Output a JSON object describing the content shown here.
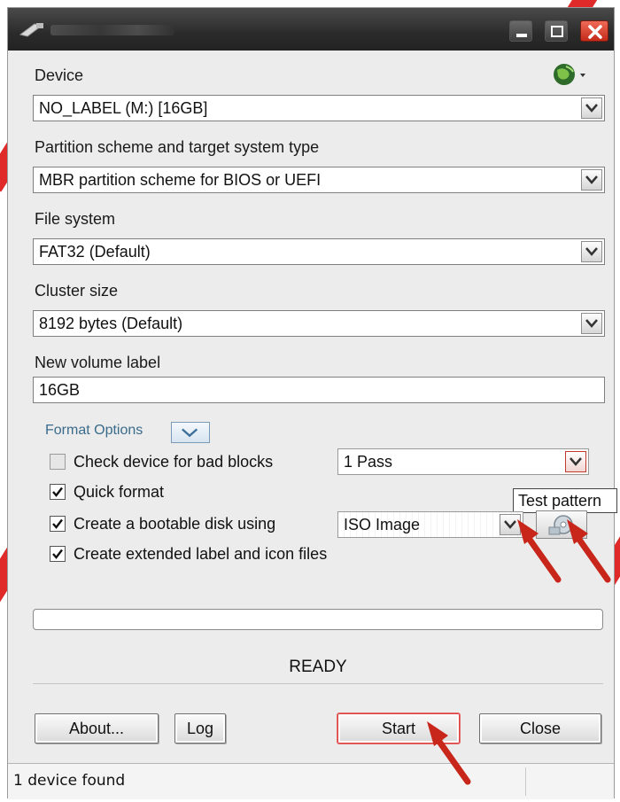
{
  "window": {
    "title": ""
  },
  "device": {
    "label": "Device",
    "value": "NO_LABEL (M:) [16GB]"
  },
  "partition": {
    "label": "Partition scheme and target system type",
    "value": "MBR partition scheme for BIOS or UEFI"
  },
  "filesystem": {
    "label": "File system",
    "value": "FAT32 (Default)"
  },
  "cluster": {
    "label": "Cluster size",
    "value": "8192 bytes (Default)"
  },
  "volume": {
    "label": "New volume label",
    "value": "16GB"
  },
  "format_options": {
    "label": "Format Options",
    "bad_blocks": {
      "label": "Check device for bad blocks",
      "checked": false,
      "passes": "1 Pass"
    },
    "quick_format": {
      "label": "Quick format",
      "checked": true
    },
    "bootable": {
      "label": "Create a bootable disk using",
      "checked": true,
      "value": "ISO Image"
    },
    "extended_label": {
      "label": "Create extended label and icon files",
      "checked": true
    }
  },
  "tooltip": "Test pattern",
  "progress": {
    "fraction": 0.0
  },
  "status": "READY",
  "buttons": {
    "about": "About...",
    "log": "Log",
    "start": "Start",
    "close": "Close"
  },
  "statusbar": {
    "text": "1 device found"
  },
  "colors": {
    "accent_red": "#d42b1e",
    "titlebar": "#2b2b2b",
    "window_bg": "#ececec"
  },
  "icons": [
    "app-icon",
    "minimize-icon",
    "maximize-icon",
    "close-icon",
    "globe-icon",
    "chevron-down-icon",
    "disk-image-icon",
    "annotation-arrow"
  ]
}
